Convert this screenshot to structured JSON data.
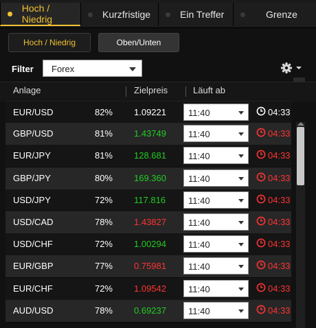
{
  "tabs": [
    {
      "label": "Hoch / Niedrig",
      "active": true
    },
    {
      "label": "Kurzfristige",
      "active": false
    },
    {
      "label": "Ein Treffer",
      "active": false
    },
    {
      "label": "Grenze",
      "active": false
    }
  ],
  "subtabs": [
    {
      "label": "Hoch / Niedrig",
      "active": true
    },
    {
      "label": "Oben/Unten",
      "active": false
    }
  ],
  "filter": {
    "label": "Filter",
    "value": "Forex"
  },
  "settings_icon": "gear-icon",
  "headers": {
    "asset": "Anlage",
    "target": "Zielpreis",
    "expires": "Läuft ab"
  },
  "colors": {
    "accent": "#f1c232",
    "up": "#22cc22",
    "down": "#ff3333",
    "expiry_alert": "#ff3333"
  },
  "rows": [
    {
      "pair": "EUR/USD",
      "pct": "82%",
      "price": "1.09221",
      "direction": "neutral",
      "time": "11:40",
      "expiry": "04:33",
      "expiry_alert": false
    },
    {
      "pair": "GBP/USD",
      "pct": "81%",
      "price": "1.43749",
      "direction": "up",
      "time": "11:40",
      "expiry": "04:33",
      "expiry_alert": true
    },
    {
      "pair": "EUR/JPY",
      "pct": "81%",
      "price": "128.681",
      "direction": "up",
      "time": "11:40",
      "expiry": "04:33",
      "expiry_alert": true
    },
    {
      "pair": "GBP/JPY",
      "pct": "80%",
      "price": "169.360",
      "direction": "up",
      "time": "11:40",
      "expiry": "04:33",
      "expiry_alert": true
    },
    {
      "pair": "USD/JPY",
      "pct": "72%",
      "price": "117.816",
      "direction": "up",
      "time": "11:40",
      "expiry": "04:33",
      "expiry_alert": true
    },
    {
      "pair": "USD/CAD",
      "pct": "78%",
      "price": "1.43827",
      "direction": "down",
      "time": "11:40",
      "expiry": "04:33",
      "expiry_alert": true
    },
    {
      "pair": "USD/CHF",
      "pct": "72%",
      "price": "1.00294",
      "direction": "up",
      "time": "11:40",
      "expiry": "04:33",
      "expiry_alert": true
    },
    {
      "pair": "EUR/GBP",
      "pct": "77%",
      "price": "0.75981",
      "direction": "down",
      "time": "11:40",
      "expiry": "04:33",
      "expiry_alert": true
    },
    {
      "pair": "EUR/CHF",
      "pct": "72%",
      "price": "1.09542",
      "direction": "down",
      "time": "11:40",
      "expiry": "04:33",
      "expiry_alert": true
    },
    {
      "pair": "AUD/USD",
      "pct": "78%",
      "price": "0.69237",
      "direction": "up",
      "time": "11:40",
      "expiry": "04:33",
      "expiry_alert": true
    }
  ]
}
